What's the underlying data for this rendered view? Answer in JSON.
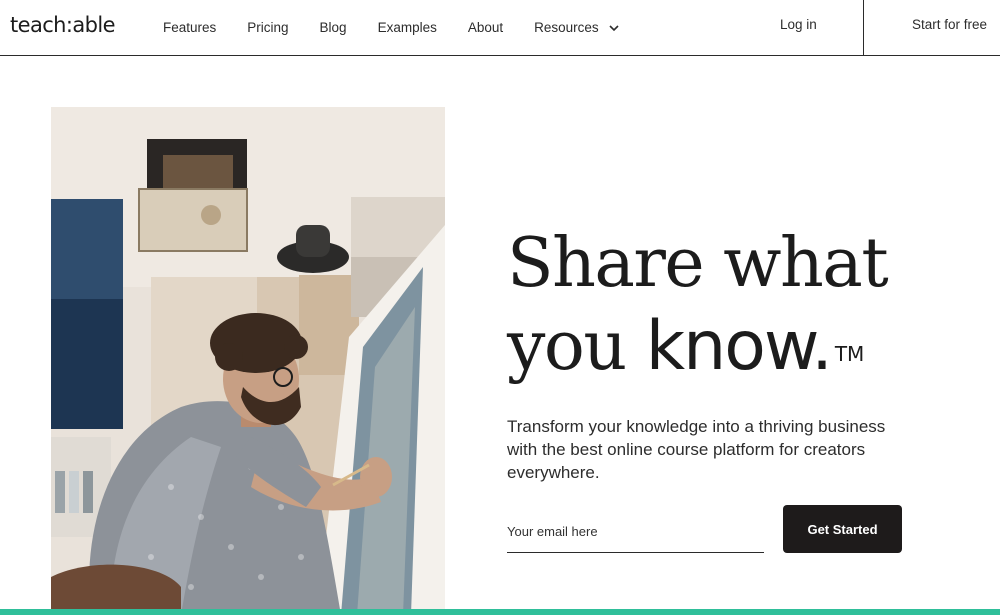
{
  "header": {
    "logo": "teach:able",
    "nav": [
      {
        "label": "Features"
      },
      {
        "label": "Pricing"
      },
      {
        "label": "Blog"
      },
      {
        "label": "Examples"
      },
      {
        "label": "About"
      },
      {
        "label": "Resources",
        "has_dropdown": true
      }
    ],
    "login_label": "Log in",
    "start_label": "Start for free"
  },
  "hero": {
    "headline_line1": "Share what",
    "headline_line2_light": "you ",
    "headline_line2_strong": "know.",
    "trademark": "TM",
    "subhead": "Transform your knowledge into a thriving business with the best online course platform for creators everywhere.",
    "email_placeholder": "Your email here",
    "cta_label": "Get Started",
    "photo_icon": "artist-painting-photo"
  },
  "colors": {
    "accent_bar": "#2fbf9a",
    "cta_bg": "#1e1b1b",
    "text": "#1c1c1c"
  }
}
